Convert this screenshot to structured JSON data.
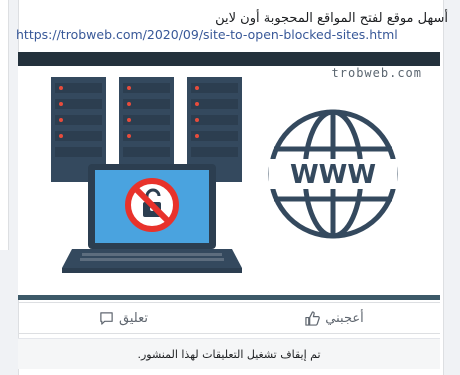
{
  "post": {
    "text": "أسهل موقع لفتح المواقع المحجوبة أون لاين",
    "link": "https://trobweb.com/2020/09/site-to-open-blocked-sites.html"
  },
  "media": {
    "watermark": "trobweb.com",
    "www_label": "WWW"
  },
  "actions": {
    "like_label": "أعجبني",
    "comment_label": "تعليق"
  },
  "footer": {
    "comments_disabled_note": "تم إيقاف تشغيل التعليقات لهذا المنشور."
  },
  "colors": {
    "link": "#385898",
    "server": "#34495e",
    "globe": "#34495e",
    "blocked_sign": "#e8322b",
    "screen": "#4aa3df"
  }
}
